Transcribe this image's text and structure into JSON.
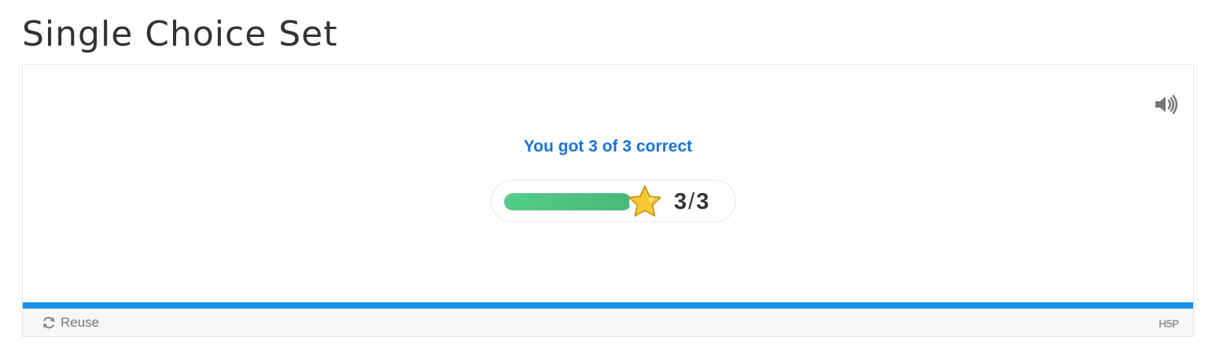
{
  "page": {
    "title": "Single Choice Set"
  },
  "result": {
    "feedback": "You got 3 of 3 correct",
    "score": "3",
    "separator": "/",
    "max_score": "3",
    "progress_fraction": 1.0
  },
  "footer": {
    "reuse_label": "Reuse",
    "logo_text": "H5P"
  },
  "icons": {
    "audio": "speaker-icon",
    "star": "star-icon",
    "reuse": "refresh-icon"
  },
  "colors": {
    "feedback_text": "#1a73d4",
    "progress_fill": "#4cc184",
    "progress_strip": "#1592e8",
    "star_fill": "#f9c932"
  }
}
